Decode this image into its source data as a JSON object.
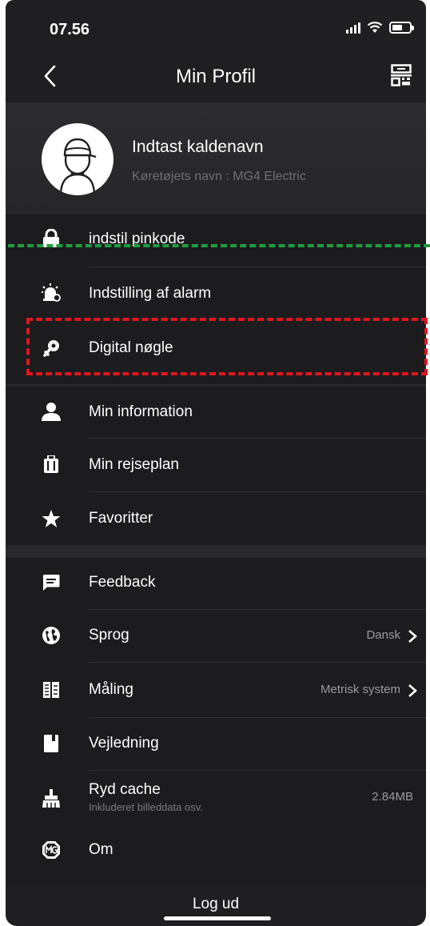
{
  "status": {
    "time": "07.56"
  },
  "nav": {
    "title": "Min Profil"
  },
  "profile": {
    "nickname": "Indtast kaldenavn",
    "vehicle": "Køretøjets navn : MG4 Electric"
  },
  "security": {
    "items": [
      {
        "label": "indstil pinkode",
        "icon": "lock-icon"
      },
      {
        "label": "Indstilling af alarm",
        "icon": "alarm-icon"
      },
      {
        "label": "Digital nøgle",
        "icon": "key-icon"
      }
    ]
  },
  "personal": {
    "items": [
      {
        "label": "Min information",
        "icon": "person-icon"
      },
      {
        "label": "Min rejseplan",
        "icon": "luggage-icon"
      },
      {
        "label": "Favoritter",
        "icon": "star-icon"
      }
    ]
  },
  "settings": {
    "feedback": "Feedback",
    "language": {
      "label": "Sprog",
      "value": "Dansk"
    },
    "measure": {
      "label": "Måling",
      "value": "Metrisk system"
    },
    "guide": "Vejledning",
    "cache": {
      "label": "Ryd cache",
      "sub": "Inkluderet billeddata osv.",
      "value": "2.84MB"
    },
    "about": "Om"
  },
  "logout": "Log ud",
  "annotations": {
    "green_line_color": "#1f9e3f",
    "red_box_color": "#e0161e"
  }
}
